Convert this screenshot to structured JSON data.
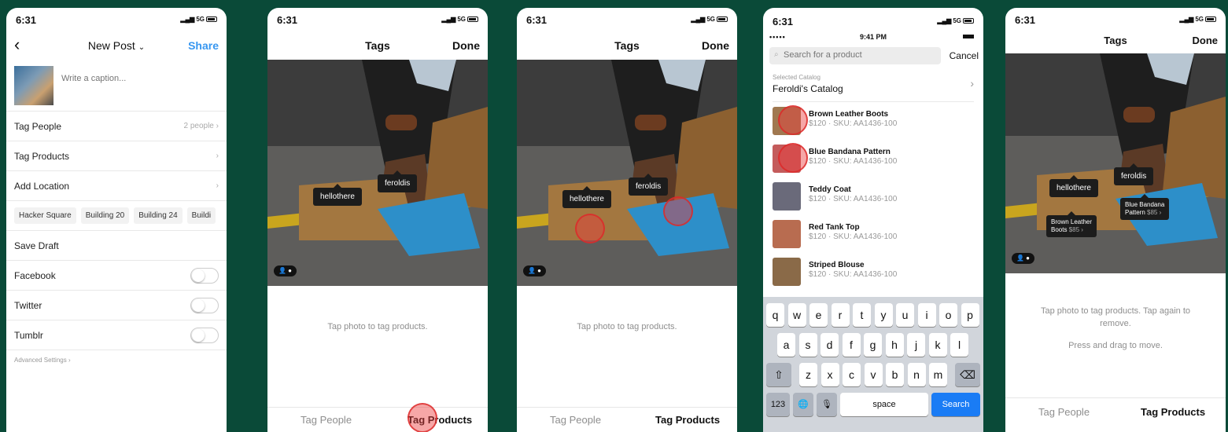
{
  "common": {
    "time": "6:31",
    "signal": "5G"
  },
  "phone1": {
    "nav_title": "New Post",
    "nav_share": "Share",
    "caption_placeholder": "Write a caption...",
    "rows": {
      "tag_people": "Tag People",
      "tag_people_count": "2 people",
      "tag_products": "Tag Products",
      "add_location": "Add Location",
      "save_draft": "Save Draft"
    },
    "locations": [
      "Hacker Square",
      "Building 20",
      "Building 24",
      "Buildi"
    ],
    "social": [
      "Facebook",
      "Twitter",
      "Tumblr"
    ],
    "advanced": "Advanced Settings"
  },
  "phone2": {
    "nav_title": "Tags",
    "nav_done": "Done",
    "tags": [
      "hellothere",
      "feroldis"
    ],
    "hint": "Tap photo to tag products.",
    "tab_people": "Tag People",
    "tab_products": "Tag Products"
  },
  "phone3": {
    "nav_title": "Tags",
    "nav_done": "Done",
    "tags": [
      "hellothere",
      "feroldis"
    ],
    "hint": "Tap photo to tag products.",
    "tab_people": "Tag People",
    "tab_products": "Tag Products"
  },
  "phone4": {
    "inner_time": "9:41 PM",
    "search_placeholder": "Search for a product",
    "cancel": "Cancel",
    "catalog_label": "Selected Catalog",
    "catalog_name": "Feroldi's Catalog",
    "products": [
      {
        "name": "Brown Leather Boots",
        "meta": "$120 · SKU: AA1436-100",
        "color": "#a07850"
      },
      {
        "name": "Blue Bandana Pattern",
        "meta": "$120 · SKU: AA1436-100",
        "color": "#c45b5b"
      },
      {
        "name": "Teddy Coat",
        "meta": "$120 · SKU: AA1436-100",
        "color": "#6a6a7a"
      },
      {
        "name": "Red Tank Top",
        "meta": "$120 · SKU: AA1436-100",
        "color": "#b86c50"
      },
      {
        "name": "Striped Blouse",
        "meta": "$120 · SKU: AA1436-100",
        "color": "#8a6a48"
      }
    ],
    "keyboard": {
      "row1": [
        "q",
        "w",
        "e",
        "r",
        "t",
        "y",
        "u",
        "i",
        "o",
        "p"
      ],
      "row2": [
        "a",
        "s",
        "d",
        "f",
        "g",
        "h",
        "j",
        "k",
        "l"
      ],
      "row3": [
        "z",
        "x",
        "c",
        "v",
        "b",
        "n",
        "m"
      ],
      "num": "123",
      "space": "space",
      "search": "Search"
    }
  },
  "phone5": {
    "nav_title": "Tags",
    "nav_done": "Done",
    "tags": [
      "hellothere",
      "feroldis"
    ],
    "product_tags": [
      {
        "name": "Brown Leather",
        "name2": "Boots",
        "price": "$85 ›"
      },
      {
        "name": "Blue Bandana",
        "name2": "Pattern",
        "price": "$85 ›"
      }
    ],
    "hint1": "Tap photo to tag products. Tap again to remove.",
    "hint2": "Press and drag to move.",
    "tab_people": "Tag People",
    "tab_products": "Tag Products"
  },
  "colors": {
    "background": "#0a4a38",
    "accent_blue": "#3897f0",
    "tap_red": "#eb3c3c",
    "keyboard_search": "#1a7cf5"
  }
}
